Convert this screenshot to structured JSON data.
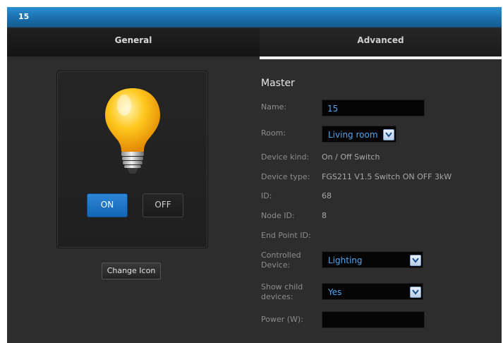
{
  "window": {
    "title": "15"
  },
  "tabs": {
    "general": "General",
    "advanced": "Advanced"
  },
  "device": {
    "on_label": "ON",
    "off_label": "OFF",
    "change_icon_label": "Change Icon",
    "state": "on",
    "icon": "lightbulb-icon"
  },
  "master": {
    "title": "Master",
    "labels": {
      "name": "Name:",
      "room": "Room:",
      "device_kind": "Device kind:",
      "device_type": "Device type:",
      "id": "ID:",
      "node_id": "Node ID:",
      "end_point_id": "End Point ID:",
      "controlled_device_1": "Controlled",
      "controlled_device_2": "Device:",
      "show_child_1": "Show child",
      "show_child_2": "devices:",
      "power": "Power (W):"
    },
    "values": {
      "name": "15",
      "room": "Living room",
      "device_kind": "On / Off Switch",
      "device_type": "FGS211 V1.5 Switch ON OFF 3kW",
      "id": "68",
      "node_id": "8",
      "end_point_id": "",
      "controlled_device": "Lighting",
      "show_child": "Yes",
      "power": ""
    }
  },
  "colors": {
    "titlebar": "#1b6fae",
    "accent": "#4da6f0",
    "on_button": "#1f73c4"
  }
}
